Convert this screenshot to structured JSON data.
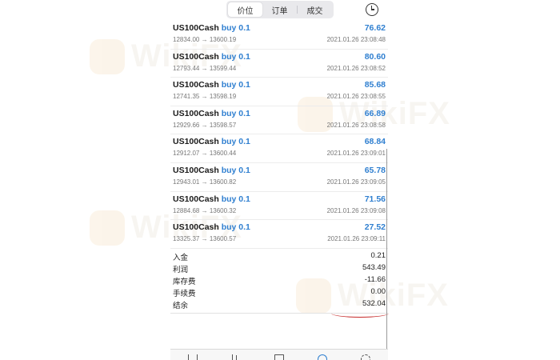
{
  "tabs": [
    {
      "label": "价位",
      "active": true
    },
    {
      "label": "订单",
      "active": false
    },
    {
      "label": "成交",
      "active": false
    }
  ],
  "trades": [
    {
      "symbol": "US100Cash",
      "direction": "buy 0.1",
      "prices": "12834.00 → 13600.19",
      "profit": "76.62",
      "time": "2021.01.26 23:08:48"
    },
    {
      "symbol": "US100Cash",
      "direction": "buy 0.1",
      "prices": "12793.44 → 13599.44",
      "profit": "80.60",
      "time": "2021.01.26 23:08:52"
    },
    {
      "symbol": "US100Cash",
      "direction": "buy 0.1",
      "prices": "12741.35 → 13598.19",
      "profit": "85.68",
      "time": "2021.01.26 23:08:55"
    },
    {
      "symbol": "US100Cash",
      "direction": "buy 0.1",
      "prices": "12929.66 → 13598.57",
      "profit": "66.89",
      "time": "2021.01.26 23:08:58"
    },
    {
      "symbol": "US100Cash",
      "direction": "buy 0.1",
      "prices": "12912.07 → 13600.44",
      "profit": "68.84",
      "time": "2021.01.26 23:09:01"
    },
    {
      "symbol": "US100Cash",
      "direction": "buy 0.1",
      "prices": "12943.01 → 13600.82",
      "profit": "65.78",
      "time": "2021.01.26 23:09:05"
    },
    {
      "symbol": "US100Cash",
      "direction": "buy 0.1",
      "prices": "12884.68 → 13600.32",
      "profit": "71.56",
      "time": "2021.01.26 23:09:08"
    },
    {
      "symbol": "US100Cash",
      "direction": "buy 0.1",
      "prices": "13325.37 → 13600.57",
      "profit": "27.52",
      "time": "2021.01.26 23:09:11"
    }
  ],
  "summary": [
    {
      "label": "入金",
      "value": "0.21"
    },
    {
      "label": "利润",
      "value": "543.49"
    },
    {
      "label": "库存费",
      "value": "-11.66"
    },
    {
      "label": "手续费",
      "value": "0.00"
    },
    {
      "label": "结余",
      "value": "532.04"
    }
  ],
  "watermark": {
    "text": "WikiFX"
  },
  "colors": {
    "accent": "#2f7fd0",
    "highlight": "#c62828"
  }
}
